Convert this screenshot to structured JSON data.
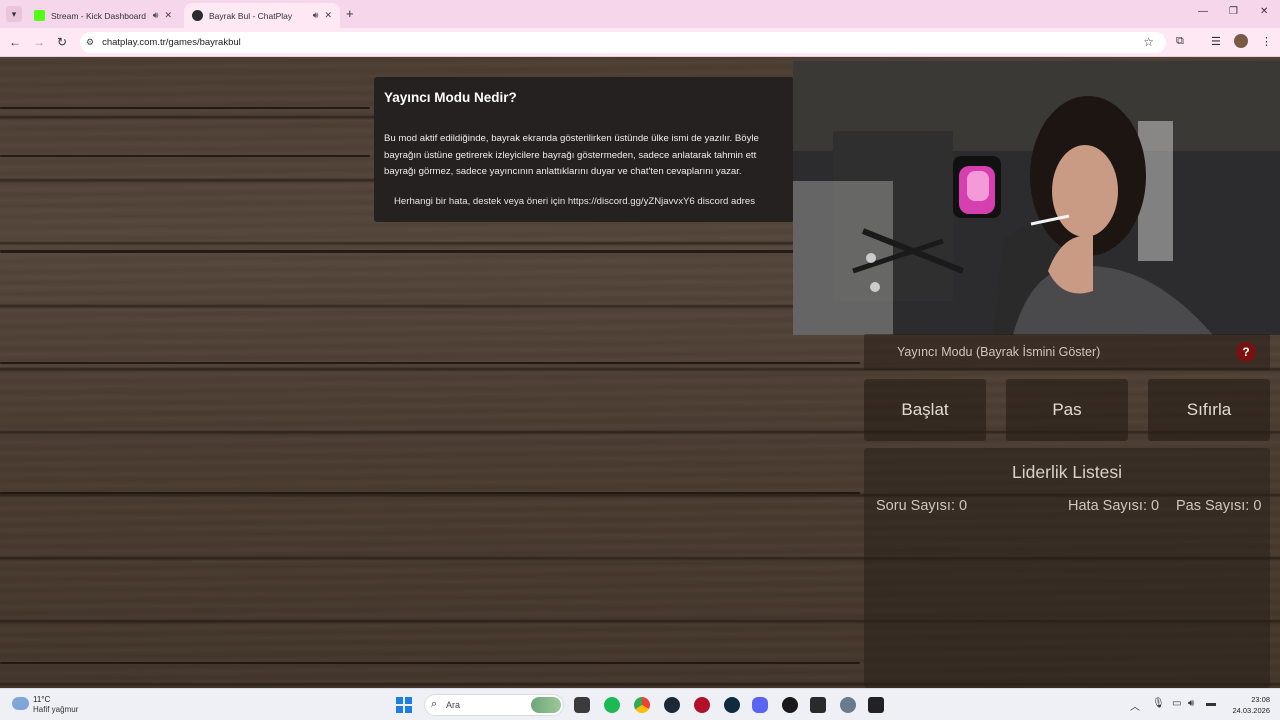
{
  "browser": {
    "tabs": [
      {
        "title": "Stream - Kick Dashboard",
        "favicon": "kick-icon",
        "color": "#53fc18"
      },
      {
        "title": "Bayrak Bul - ChatPlay",
        "favicon": "chatplay-icon",
        "color": "#2b2b2b"
      }
    ],
    "url": "chatplay.com.tr/games/bayrakbul"
  },
  "modal": {
    "title": "Yayıncı Modu Nedir?",
    "body": [
      "Bu mod aktif edildiğinde, bayrak ekranda gösterilirken üstünde ülke ismi de yazılır. Böyle",
      "bayrağın üstüne getirerek izleyicilere bayrağı göstermeden, sadece anlatarak tahmin ett",
      "bayrağı görmez, sadece yayıncının anlattıklarını duyar ve chat'ten cevaplarını yazar."
    ],
    "footer": "Herhangi bir hata, destek veya öneri için https://discord.gg/yZNjavvxY6 discord adres"
  },
  "controls": {
    "streamer_mode_label": "Yayıncı Modu (Bayrak İsmini Göster)",
    "help_label": "?",
    "start_label": "Başlat",
    "pass_label": "Pas",
    "reset_label": "Sıfırla"
  },
  "leaderboard": {
    "title": "Liderlik Listesi",
    "question_count": "Soru Sayısı: 0",
    "error_count": "Hata Sayısı: 0",
    "pass_count": "Pas Sayısı: 0"
  },
  "taskbar": {
    "weather_temp": "11°C",
    "weather_desc": "Hafif yağmur",
    "search_placeholder": "Ara",
    "time": "23:08",
    "date": "24.03.2026"
  },
  "colors": {
    "help_button": "#7a1111",
    "tab_strip": "#f6d6ea"
  }
}
